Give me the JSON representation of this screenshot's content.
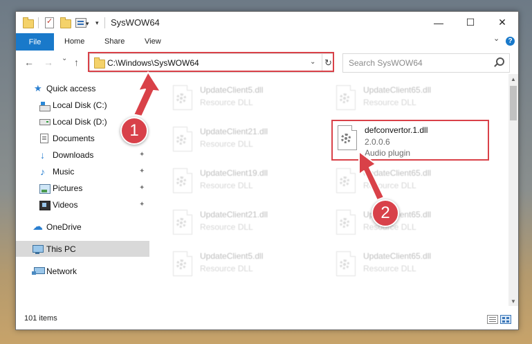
{
  "window": {
    "title": "SysWOW64",
    "minimize_glyph": "—",
    "maximize_glyph": "☐",
    "close_glyph": "✕"
  },
  "ribbon": {
    "tabs": [
      "File",
      "Home",
      "Share",
      "View"
    ],
    "expand_glyph": "⌄",
    "help_glyph": "?"
  },
  "nav": {
    "back_glyph": "←",
    "forward_glyph": "→",
    "recent_glyph": "⌄",
    "up_glyph": "↑",
    "address": "C:\\Windows\\SysWOW64",
    "address_dropdown_glyph": "⌄",
    "refresh_glyph": "↻",
    "search_placeholder": "Search SysWOW64"
  },
  "sidebar": {
    "items": [
      {
        "label": "Quick access",
        "icon": "star-icon",
        "pinned": false
      },
      {
        "label": "Local Disk (C:)",
        "icon": "drive-icon",
        "pinned": false
      },
      {
        "label": "Local Disk (D:)",
        "icon": "drive-icon",
        "pinned": false
      },
      {
        "label": "Documents",
        "icon": "documents-icon",
        "pinned": true
      },
      {
        "label": "Downloads",
        "icon": "download-icon",
        "pinned": true
      },
      {
        "label": "Music",
        "icon": "music-icon",
        "pinned": true
      },
      {
        "label": "Pictures",
        "icon": "pictures-icon",
        "pinned": true
      },
      {
        "label": "Videos",
        "icon": "videos-icon",
        "pinned": true
      },
      {
        "label": "OneDrive",
        "icon": "onedrive-icon",
        "pinned": false
      },
      {
        "label": "This PC",
        "icon": "this-pc-icon",
        "pinned": false,
        "selected": true
      },
      {
        "label": "Network",
        "icon": "network-icon",
        "pinned": false
      }
    ],
    "pin_glyph": "📌"
  },
  "files": {
    "ghost": [
      {
        "name": "UpdateClient5.dll",
        "type": "Resource DLL"
      },
      {
        "name": "UpdateClient65.dll",
        "type": "Resource DLL"
      },
      {
        "name": "UpdateClient21.dll",
        "type": "Resource DLL"
      },
      {
        "name": "UpdateClient19.dll",
        "type": "Resource DLL"
      },
      {
        "name": "UpdateClient65.dll",
        "type": "Resource DLL"
      },
      {
        "name": "UpdateClient21.dll",
        "type": "Resource DLL"
      },
      {
        "name": "UpdateClient65.dll",
        "type": "Resource DLL"
      },
      {
        "name": "UpdateClient5.dll",
        "type": "Resource DLL"
      },
      {
        "name": "UpdateClient65.dll",
        "type": "Resource DLL"
      }
    ],
    "highlighted": {
      "name": "defconvertor.1.dll",
      "version": "2.0.0.6",
      "description": "Audio plugin"
    }
  },
  "status": {
    "item_count": "101 items"
  },
  "annotations": {
    "step1": "1",
    "step2": "2",
    "color": "#d94148"
  },
  "scroll": {
    "up_glyph": "▲",
    "down_glyph": "▼"
  }
}
